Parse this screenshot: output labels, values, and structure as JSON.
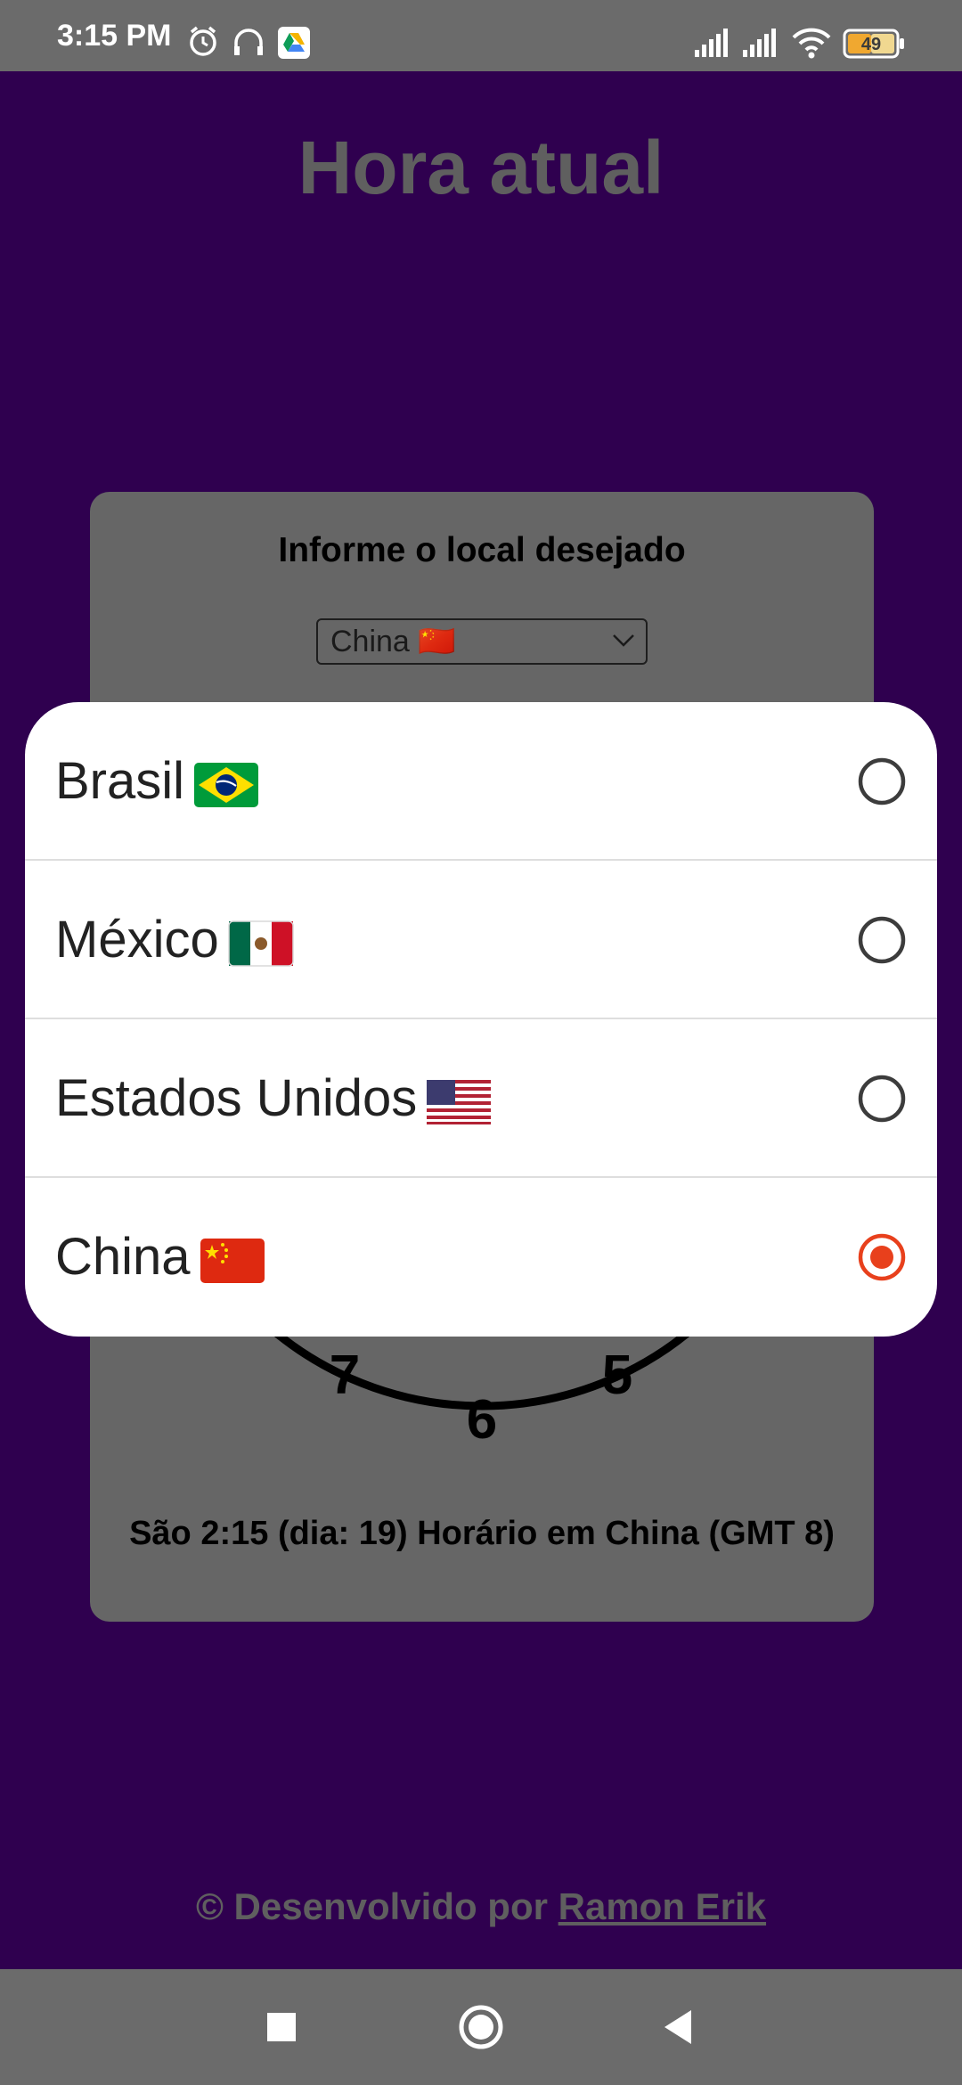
{
  "status_bar": {
    "time": "3:15 PM",
    "battery_level": "49",
    "icons": [
      "alarm-icon",
      "headphones-icon",
      "drive-icon",
      "signal-icon",
      "signal-icon",
      "wifi-icon",
      "battery-icon"
    ]
  },
  "app": {
    "title": "Hora atual",
    "prompt": "Informe o local desejado",
    "selected_option": "China 🇨🇳",
    "clock_numbers_visible": [
      "7",
      "6",
      "5"
    ],
    "time_text": "São 2:15 (dia: 19) Horário em China (GMT 8)",
    "credit_prefix": "© Desenvolvido por ",
    "credit_link": "Ramon Erik"
  },
  "picker": {
    "options": [
      {
        "label": "Brasil",
        "flag": "brazil-flag-icon",
        "selected": false
      },
      {
        "label": "México",
        "flag": "mexico-flag-icon",
        "selected": false
      },
      {
        "label": "Estados Unidos",
        "flag": "usa-flag-icon",
        "selected": false
      },
      {
        "label": "China",
        "flag": "china-flag-icon",
        "selected": true
      }
    ]
  },
  "colors": {
    "background": "#2f004f",
    "card": "#666666",
    "radio_selected": "#e8401c",
    "radio_unselected": "#3c3c3c"
  },
  "nav_bar": {
    "buttons": [
      "recents-square-icon",
      "home-circle-icon",
      "back-triangle-icon"
    ]
  }
}
